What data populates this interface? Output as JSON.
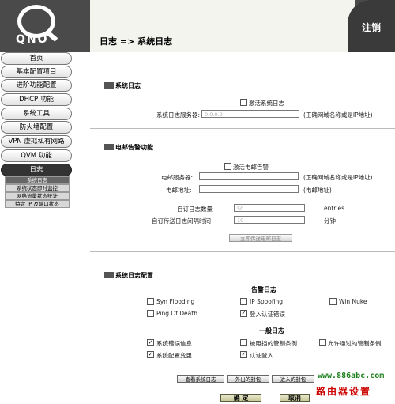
{
  "brand": "QNO",
  "breadcrumb": "日志 => 系统日志",
  "logout": "注销",
  "nav": [
    {
      "label": "首页"
    },
    {
      "label": "基本配置项目"
    },
    {
      "label": "进阶功能配置"
    },
    {
      "label": "DHCP 功能"
    },
    {
      "label": "系统工具"
    },
    {
      "label": "防火墙配置"
    },
    {
      "label": "VPN 虚拟私有网路"
    },
    {
      "label": "QVM 功能"
    },
    {
      "label": "日志"
    }
  ],
  "subnav": [
    {
      "label": "系统日志"
    },
    {
      "label": "系统状态即时监控"
    },
    {
      "label": "网络流量状态统计"
    },
    {
      "label": "特定 IP 及端口状态"
    }
  ],
  "syslog": {
    "title": "系统日志",
    "enable_label": "激活系统日志",
    "server_label": "系统日志服务器:",
    "server_value": "0.0.0.0",
    "server_hint": "(正确网域名称或是IP地址)"
  },
  "email": {
    "title": "电邮告警功能",
    "enable_label": "激活电邮告警",
    "server_label": "电邮服务器:",
    "server_hint": "(正确网域名称或是IP地址)",
    "address_label": "电邮地址:",
    "address_hint": "(电邮地址)",
    "count_label": "自订日志数量",
    "count_value": "50",
    "count_unit": "entries",
    "interval_label": "自订传送日志间隔时间",
    "interval_value": "10",
    "interval_unit": "分钟",
    "send_now": "立即传送电邮日志"
  },
  "config": {
    "title": "系统日志配置",
    "alert_head": "告警日志",
    "general_head": "一般日志",
    "alert_items": [
      {
        "label": "Syn Flooding",
        "checked": false
      },
      {
        "label": "IP Spoofing",
        "checked": false
      },
      {
        "label": "Win Nuke",
        "checked": false
      },
      {
        "label": "Ping Of Death",
        "checked": false
      },
      {
        "label": "登入认证错误",
        "checked": true
      }
    ],
    "general_items": [
      {
        "label": "系统错误信息",
        "checked": true
      },
      {
        "label": "被阻挡的管制条例",
        "checked": false
      },
      {
        "label": "允许通过的管制条例",
        "checked": false
      },
      {
        "label": "系统配置变更",
        "checked": true
      },
      {
        "label": "认证登入",
        "checked": true
      }
    ]
  },
  "buttons": {
    "view_log": "查看系统日志",
    "outgoing": "外出的封包",
    "incoming": "进入的封包",
    "ok": "确 定",
    "cancel": "取消"
  },
  "watermark": {
    "url": "www.886abc.com",
    "name": "路由器设置"
  }
}
